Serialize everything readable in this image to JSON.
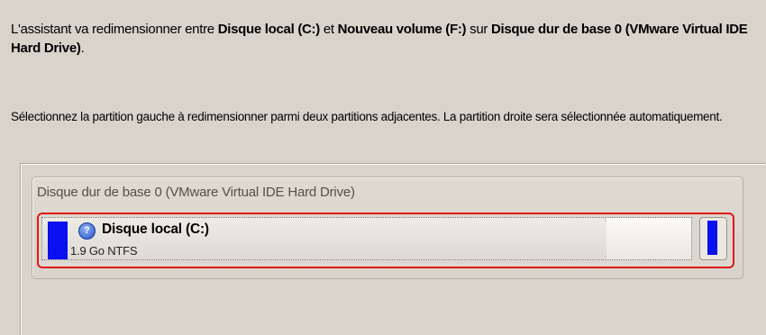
{
  "intro": {
    "prefix": "L'assistant va redimensionner entre ",
    "partition_left": "Disque local (C:)",
    "middle": " et ",
    "partition_right": "Nouveau volume (F:)",
    "on": " sur ",
    "disk": "Disque dur de base 0 (VMware Virtual IDE Hard Drive)",
    "suffix": "."
  },
  "instruction": "Sélectionnez la partition gauche à redimensionner parmi deux partitions adjacentes. La partition droite sera sélectionnée automatiquement.",
  "disk": {
    "title": "Disque dur de base 0 (VMware Virtual IDE Hard Drive)",
    "partitions": [
      {
        "name": "Disque local (C:)",
        "info": "1.9 Go NTFS",
        "icon": "help-icon",
        "color": "#0a10f0",
        "used_fraction": 0.87,
        "selected": true
      },
      {
        "name": "",
        "info": "",
        "color": "#0a10f0",
        "selected": true
      }
    ]
  },
  "colors": {
    "background": "#d8d4cc",
    "selection": "#e01818",
    "partition_bar": "#0a10f0"
  }
}
